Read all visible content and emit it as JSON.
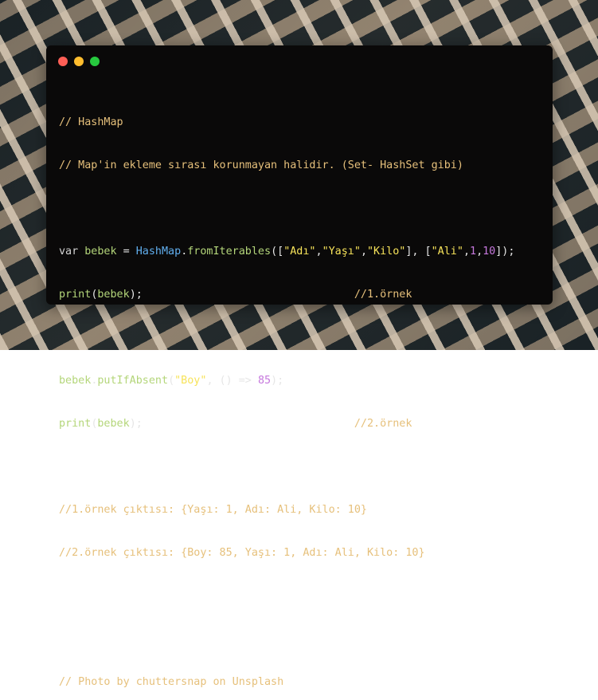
{
  "window": {
    "controls": {
      "close_color": "#ff5f56",
      "minimize_color": "#ffbd2e",
      "maximize_color": "#27c93f"
    }
  },
  "code": {
    "line1": "// HashMap",
    "line2": "// Map'in ekleme sırası korunmayan halidir. (Set- HashSet gibi)",
    "line3": {
      "kw_var": "var",
      "ident": "bebek",
      "eq": " = ",
      "type": "HashMap",
      "dot": ".",
      "method": "fromIterables",
      "open": "([",
      "s1": "\"Adı\"",
      "c1": ",",
      "s2": "\"Yaşı\"",
      "c2": ",",
      "s3": "\"Kilo\"",
      "mid": "], [",
      "s4": "\"Ali\"",
      "c3": ",",
      "n1": "1",
      "c4": ",",
      "n2": "10",
      "close": "]);"
    },
    "line4": {
      "call": "print",
      "open": "(",
      "arg": "bebek",
      "close": ");",
      "pad": "                                 ",
      "comment": "//1.örnek"
    },
    "line6": {
      "ident": "bebek",
      "dot": ".",
      "method": "putIfAbsent",
      "open": "(",
      "s1": "\"Boy\"",
      "mid": ", () => ",
      "n1": "85",
      "close": ");"
    },
    "line7": {
      "call": "print",
      "open": "(",
      "arg": "bebek",
      "close": ");",
      "pad": "                                 ",
      "comment": "//2.örnek"
    },
    "line9": "//1.örnek çıktısı: {Yaşı: 1, Adı: Ali, Kilo: 10}",
    "line10": "//2.örnek çıktısı: {Boy: 85, Yaşı: 1, Adı: Ali, Kilo: 10}",
    "line13": "// Photo by chuttersnap on Unsplash"
  }
}
